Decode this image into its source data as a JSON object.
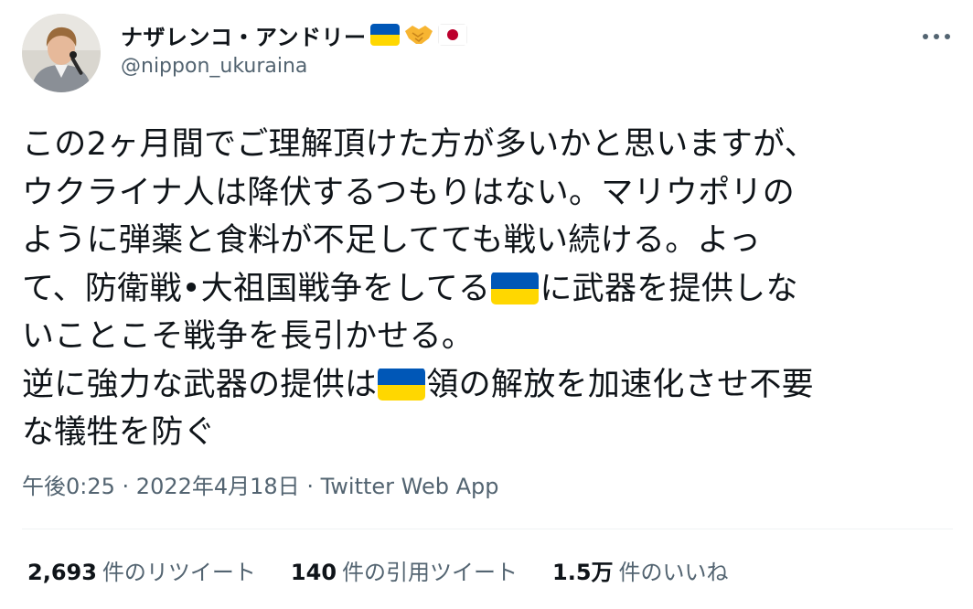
{
  "tweet": {
    "author": {
      "display_name": "ナザレンコ・アンドリー",
      "name_emojis": [
        "flag-ukraine",
        "handshake",
        "flag-japan"
      ],
      "handle": "@nippon_ukuraina"
    },
    "more_label": "•••",
    "body_lines": [
      {
        "segments": [
          {
            "t": "text",
            "v": "この2ヶ月間でご理解頂けた方が多いかと思いますが、"
          }
        ]
      },
      {
        "segments": [
          {
            "t": "text",
            "v": "ウクライナ人は降伏するつもりはない。マリウポリの"
          }
        ]
      },
      {
        "segments": [
          {
            "t": "text",
            "v": "ように弾薬と食料が不足してても戦い続ける。よっ"
          }
        ]
      },
      {
        "segments": [
          {
            "t": "text",
            "v": "て、防衛戦•大祖国戦争をしてる"
          },
          {
            "t": "flag",
            "v": "flag-ukraine"
          },
          {
            "t": "text",
            "v": "に武器を提供しな"
          }
        ]
      },
      {
        "segments": [
          {
            "t": "text",
            "v": "いことこそ戦争を長引かせる。"
          }
        ]
      },
      {
        "segments": [
          {
            "t": "text",
            "v": "逆に強力な武器の提供は"
          },
          {
            "t": "flag",
            "v": "flag-ukraine"
          },
          {
            "t": "text",
            "v": "領の解放を加速化させ不要"
          }
        ]
      },
      {
        "segments": [
          {
            "t": "text",
            "v": "な犠牲を防ぐ"
          }
        ]
      }
    ],
    "time": "午後0:25",
    "separator": " · ",
    "date": "2022年4月18日",
    "source": "Twitter Web App",
    "stats": {
      "retweets": {
        "num": "2,693",
        "label": "件のリツイート"
      },
      "quotes": {
        "num": "140",
        "label": "件の引用ツイート"
      },
      "likes": {
        "num": "1.5万",
        "label": "件のいいね"
      }
    }
  },
  "colors": {
    "text": "#0f1419",
    "secondary": "#536471",
    "divider": "#eff3f4",
    "ukraine_blue": "#0057b7",
    "ukraine_yellow": "#ffd700",
    "japan_red": "#bc002d"
  }
}
